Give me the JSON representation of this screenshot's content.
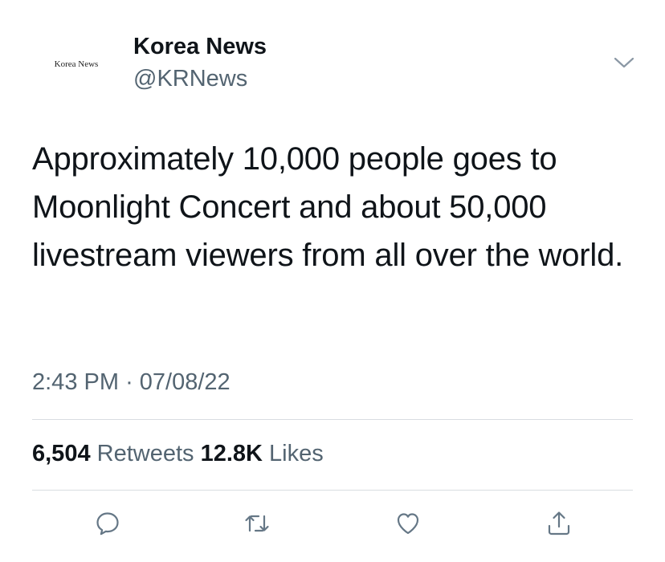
{
  "account": {
    "display_name": "Korea News",
    "handle": "@KRNews",
    "avatar_text": "Korea News"
  },
  "tweet": {
    "text": "Approximately 10,000 people goes to Moonlight Concert and about 50,000 livestream viewers from all over the world.",
    "time": "2:43 PM",
    "separator": "·",
    "date": "07/08/22"
  },
  "stats": {
    "retweets_count": "6,504",
    "retweets_label": "Retweets",
    "likes_count": "12.8K",
    "likes_label": "Likes"
  },
  "icons": {
    "caret": "chevron-down-icon",
    "reply": "reply-icon",
    "retweet": "retweet-icon",
    "like": "heart-icon",
    "share": "share-icon"
  },
  "colors": {
    "text": "#0f1419",
    "secondary": "#536471",
    "divider": "#d9dde1"
  }
}
